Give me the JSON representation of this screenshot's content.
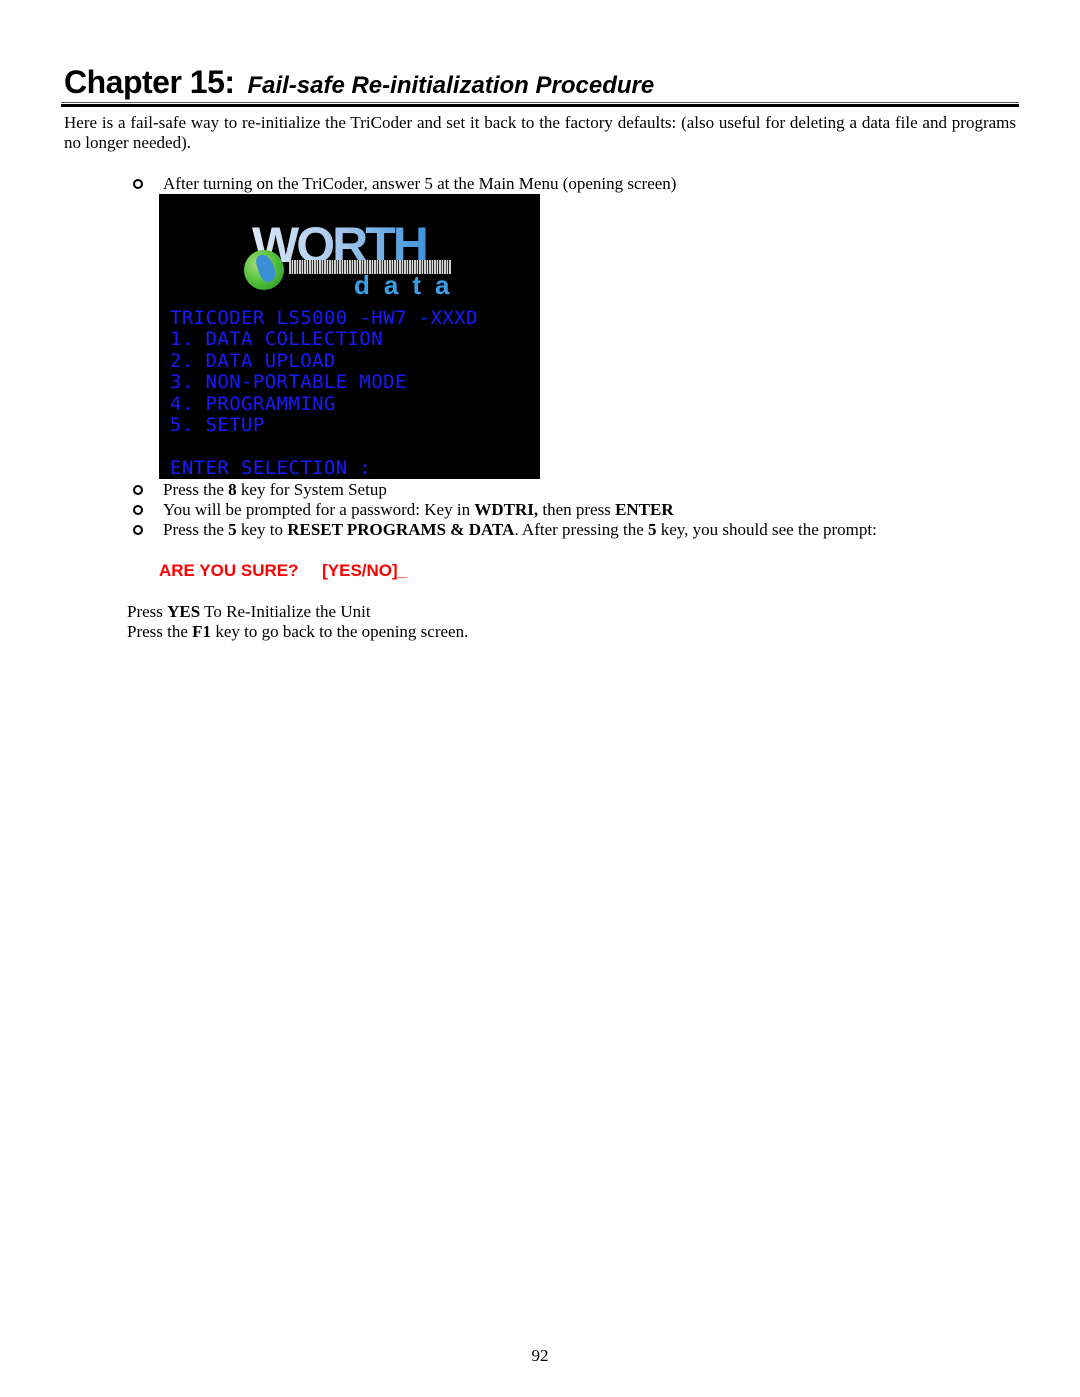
{
  "chapter": {
    "label": "Chapter 15:",
    "subtitle": "Fail-safe Re-initialization Procedure"
  },
  "intro": "Here is a fail-safe way to re-initialize the TriCoder and set it back to the factory defaults: (also useful for deleting a data file and programs no longer needed).",
  "steps": {
    "step1": "After turning on the TriCoder, answer 5 at the Main Menu (opening screen)",
    "step2": {
      "pre": "Press the ",
      "key": "8",
      "post": " key for System Setup"
    },
    "step3": {
      "pre": "You will be prompted for a password: Key in ",
      "password": "WDTRI,",
      "mid": " then press ",
      "key": "ENTER"
    },
    "step4": {
      "pre": "Press the ",
      "key": "5",
      "mid1": " key to ",
      "action": "RESET PROGRAMS & DATA",
      "mid2": ".  After pressing the ",
      "key2": "5",
      "post": " key, you should see the prompt:"
    }
  },
  "screen": {
    "logo": {
      "brand": "WORTH",
      "sub": "data"
    },
    "lines": [
      "TRICODER LS5000 -HW7 -XXXD",
      "1. DATA COLLECTION",
      "2. DATA UPLOAD",
      "3. NON-PORTABLE MODE",
      "4. PROGRAMMING",
      "5. SETUP",
      "",
      "ENTER SELECTION :"
    ],
    "text_color": "#1a1aff",
    "background": "#000000"
  },
  "prompt": {
    "question": "ARE YOU SURE?",
    "options": "[YES/NO]_",
    "color": "#ff0000"
  },
  "after": {
    "line1": {
      "pre": "Press ",
      "key": "YES",
      "post": " To Re-Initialize the Unit"
    },
    "line2": {
      "pre": "Press the ",
      "key": "F1",
      "post": " key to go back to the opening screen."
    }
  },
  "page_number": "92"
}
